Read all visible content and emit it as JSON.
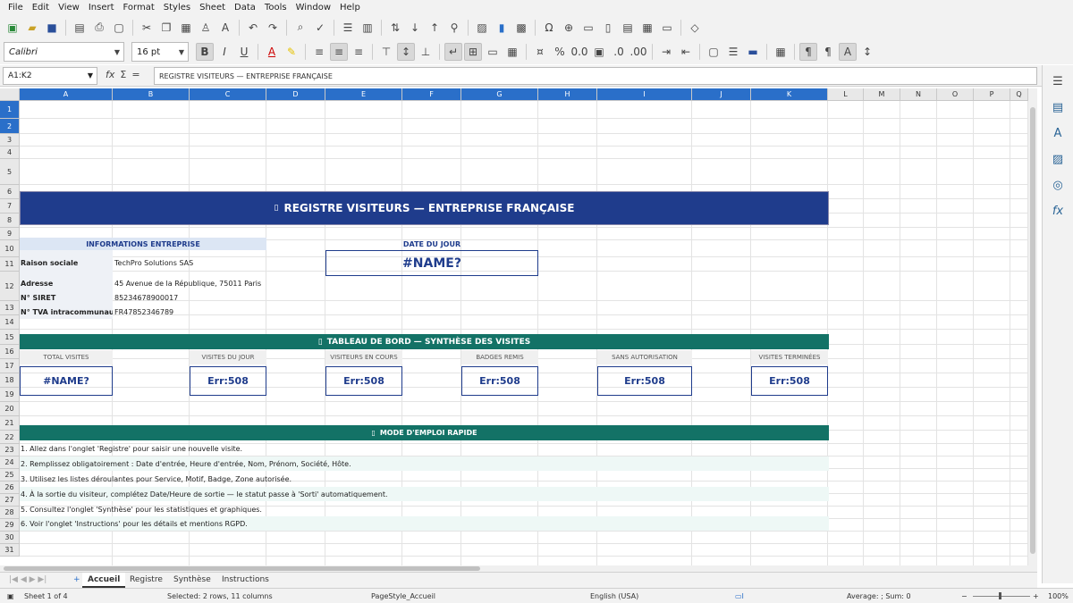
{
  "menu": [
    "File",
    "Edit",
    "View",
    "Insert",
    "Format",
    "Styles",
    "Sheet",
    "Data",
    "Tools",
    "Window",
    "Help"
  ],
  "font": {
    "name": "Calibri",
    "size": "16 pt"
  },
  "namebox": "A1:K2",
  "formula": "REGISTRE VISITEURS — ENTREPRISE FRANÇAISE",
  "columns": [
    "A",
    "B",
    "C",
    "D",
    "E",
    "F",
    "G",
    "H",
    "I",
    "J",
    "K",
    "L",
    "M",
    "N",
    "O",
    "P",
    "Q"
  ],
  "rows": [
    "1",
    "2",
    "3",
    "4",
    "5",
    "6",
    "7",
    "8",
    "9",
    "10",
    "11",
    "12",
    "13",
    "14",
    "15",
    "16",
    "17",
    "18",
    "19",
    "20",
    "21",
    "22",
    "23",
    "24",
    "25",
    "26",
    "27",
    "28",
    "29",
    "30",
    "31"
  ],
  "sheet": {
    "title": "REGISTRE VISITEURS — ENTREPRISE FRANÇAISE",
    "info_header": "INFORMATIONS ENTREPRISE",
    "date_header": "DATE DU JOUR",
    "date_value": "#NAME?",
    "info": [
      {
        "label": "Raison sociale",
        "value": "TechPro Solutions SAS"
      },
      {
        "label": "Adresse",
        "value": "45 Avenue de la République, 75011 Paris"
      },
      {
        "label": "N° SIRET",
        "value": "85234678900017"
      },
      {
        "label": "N° TVA intracommunautaire",
        "value": "FR47852346789"
      }
    ],
    "dashboard_header": "TABLEAU DE BORD — SYNTHÈSE DES VISITES",
    "kpis": [
      {
        "label": "TOTAL VISITES",
        "value": "#NAME?"
      },
      {
        "label": "VISITES DU JOUR",
        "value": "Err:508"
      },
      {
        "label": "VISITEURS EN COURS",
        "value": "Err:508"
      },
      {
        "label": "BADGES REMIS",
        "value": "Err:508"
      },
      {
        "label": "SANS AUTORISATION",
        "value": "Err:508"
      },
      {
        "label": "VISITES TERMINÉES",
        "value": "Err:508"
      }
    ],
    "howto_header": "MODE D'EMPLOI RAPIDE",
    "steps": [
      "1. Allez dans l'onglet 'Registre' pour saisir une nouvelle visite.",
      "2. Remplissez obligatoirement : Date d'entrée, Heure d'entrée, Nom, Prénom, Société, Hôte.",
      "3. Utilisez les listes déroulantes pour Service, Motif, Badge, Zone autorisée.",
      "4. À la sortie du visiteur, complétez Date/Heure de sortie — le statut passe à 'Sorti' automatiquement.",
      "5. Consultez l'onglet 'Synthèse' pour les statistiques et graphiques.",
      "6. Voir l'onglet 'Instructions' pour les détails et mentions RGPD."
    ]
  },
  "tabs": [
    "Accueil",
    "Registre",
    "Synthèse",
    "Instructions"
  ],
  "status": {
    "sheet": "Sheet 1 of 4",
    "selection": "Selected: 2 rows, 11 columns",
    "pagestyle": "PageStyle_Accueil",
    "language": "English (USA)",
    "sum": "Average: ; Sum: 0",
    "zoom": "100%"
  },
  "colors": {
    "title_bg": "#1f3c8c",
    "teal": "#137266",
    "light_blue": "#dce6f4",
    "kpi_border": "#1f3c8c"
  }
}
